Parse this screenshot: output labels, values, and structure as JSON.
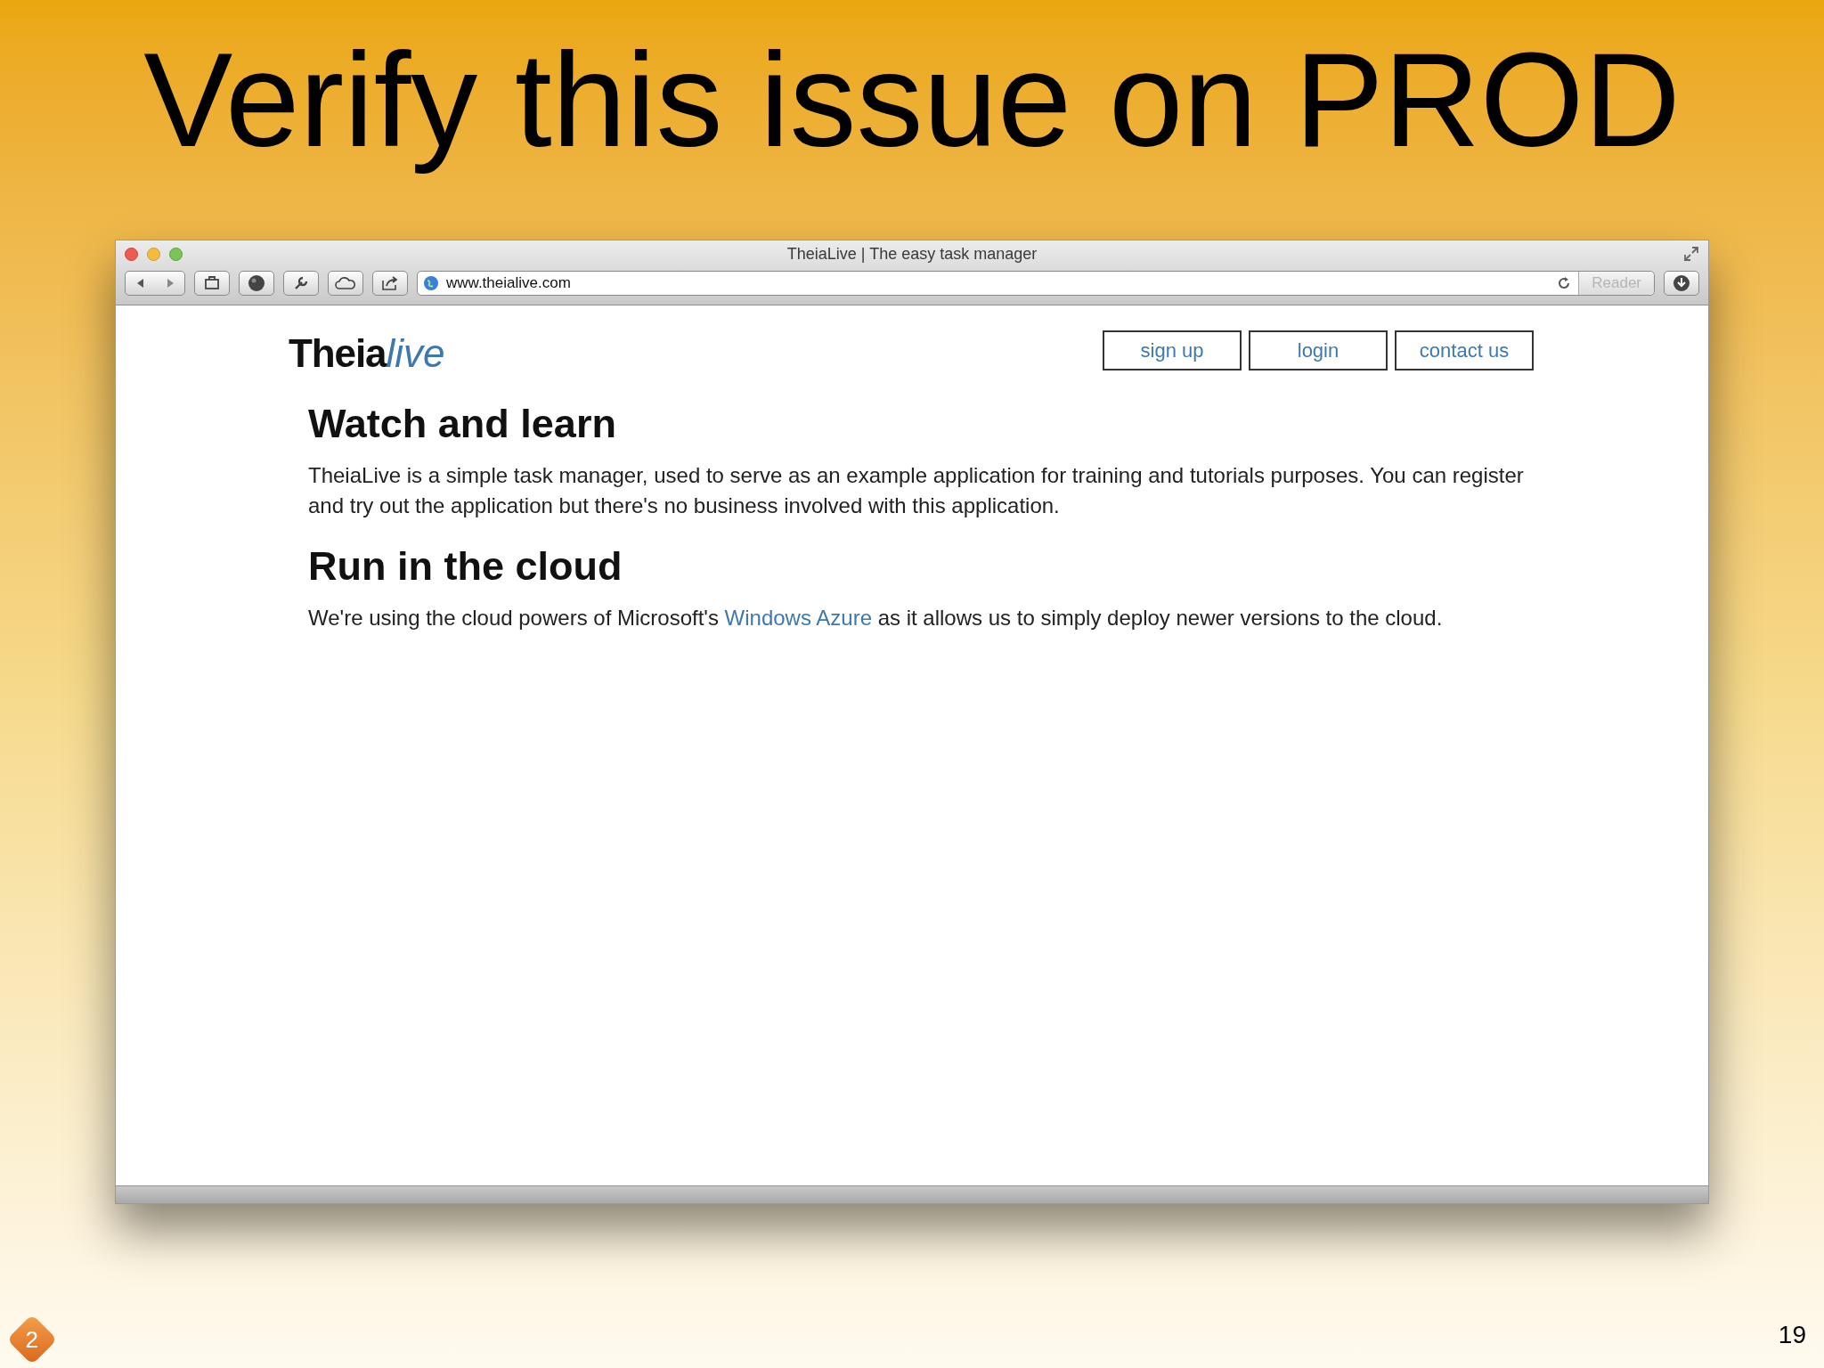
{
  "slide": {
    "title": "Verify this issue on PROD",
    "badge": "2",
    "page_number": "19"
  },
  "browser": {
    "title": "TheiaLive | The easy task manager",
    "url": "www.theialive.com",
    "reader": "Reader"
  },
  "site": {
    "logo": {
      "main": "Theia",
      "accent": "live"
    },
    "nav": [
      "sign up",
      "login",
      "contact us"
    ],
    "sections": [
      {
        "heading": "Watch and learn",
        "body": [
          {
            "kind": "text",
            "text": "TheiaLive is a simple task manager, used to serve as an example application for training and tutorials purposes. You can register and try out the application but there's no business involved with this application."
          }
        ]
      },
      {
        "heading": "Run in the cloud",
        "body": [
          {
            "kind": "text",
            "text": "We're using the cloud powers of Microsoft's "
          },
          {
            "kind": "link",
            "text": "Windows Azure"
          },
          {
            "kind": "text",
            "text": " as it allows us to simply deploy newer versions to the cloud."
          }
        ]
      }
    ]
  }
}
